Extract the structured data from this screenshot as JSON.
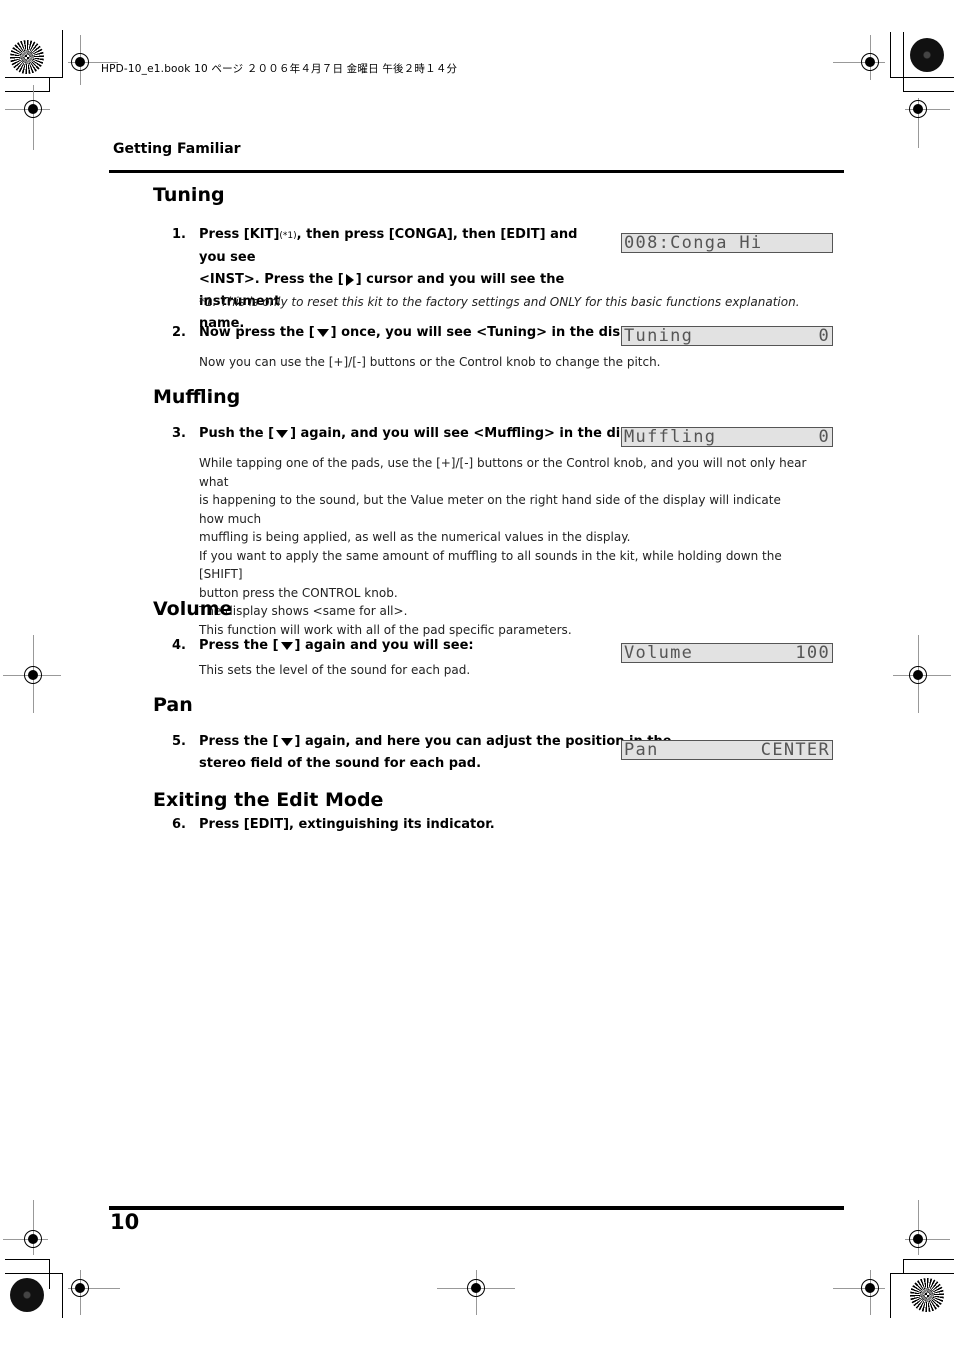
{
  "slug": "HPD-10_e1.book  10 ページ  ２００６年４月７日  金曜日  午後２時１４分",
  "running_header": "Getting Familiar",
  "page_number": "10",
  "sections": {
    "tuning": {
      "title": "Tuning",
      "step1": {
        "num": "1.",
        "text_a": "Press [KIT]",
        "footnote_ref": "(*1)",
        "text_b": ", then press [CONGA], then [EDIT] and you see",
        "line2_a": "<INST>. Press the [",
        "line2_b": "] cursor and you will see the instrument",
        "line3": "name.",
        "icon": "right-triangle"
      },
      "footnote": "*1: This is only to reset this kit to the factory settings and ONLY for this basic functions explanation.",
      "lcd1": {
        "left": "008:Conga Hi",
        "right": ""
      },
      "step2": {
        "num": "2.",
        "text_a": "Now press the [",
        "text_b": "] once, you will see <Tuning> in the display.",
        "icon": "down-triangle"
      },
      "lcd2": {
        "left": "Tuning",
        "right": "0"
      },
      "body": "Now you can use the [+]/[-] buttons or the Control knob to change the pitch."
    },
    "muffling": {
      "title": "Muffling",
      "step3": {
        "num": "3.",
        "text_a": "Push the [",
        "text_b": "] again, and you will see <Muffling> in the display.",
        "icon": "down-triangle"
      },
      "lcd": {
        "left": "Muffling",
        "right": "0"
      },
      "body": [
        "While tapping one of the pads, use the [+]/[-] buttons or the Control knob, and you will not only hear what",
        "is happening to the sound, but the Value meter on the right hand side of the display will indicate how much",
        "muffling is being applied, as well as the numerical values in the display.",
        "If you want to apply the same amount of muffling to all sounds in the kit, while holding down the [SHIFT]",
        "button press the CONTROL knob.",
        "The display shows <same for all>.",
        "This function will work with all of the pad specific parameters."
      ]
    },
    "volume": {
      "title": "Volume",
      "step4": {
        "num": "4.",
        "text_a": "Press the [",
        "text_b": "] again and you will see:",
        "icon": "down-triangle"
      },
      "lcd": {
        "left": "Volume",
        "right": "100"
      },
      "body": "This sets the level of the sound for each pad."
    },
    "pan": {
      "title": "Pan",
      "step5": {
        "num": "5.",
        "text_a": "Press the [",
        "text_b": "] again, and here you can adjust the position in the",
        "line2": "stereo field of the sound for each pad.",
        "icon": "down-triangle"
      },
      "lcd": {
        "left": "Pan",
        "right": "CENTER"
      }
    },
    "exit": {
      "title": "Exiting the Edit Mode",
      "step6": {
        "num": "6.",
        "text": "Press [EDIT], extinguishing its indicator."
      }
    }
  }
}
